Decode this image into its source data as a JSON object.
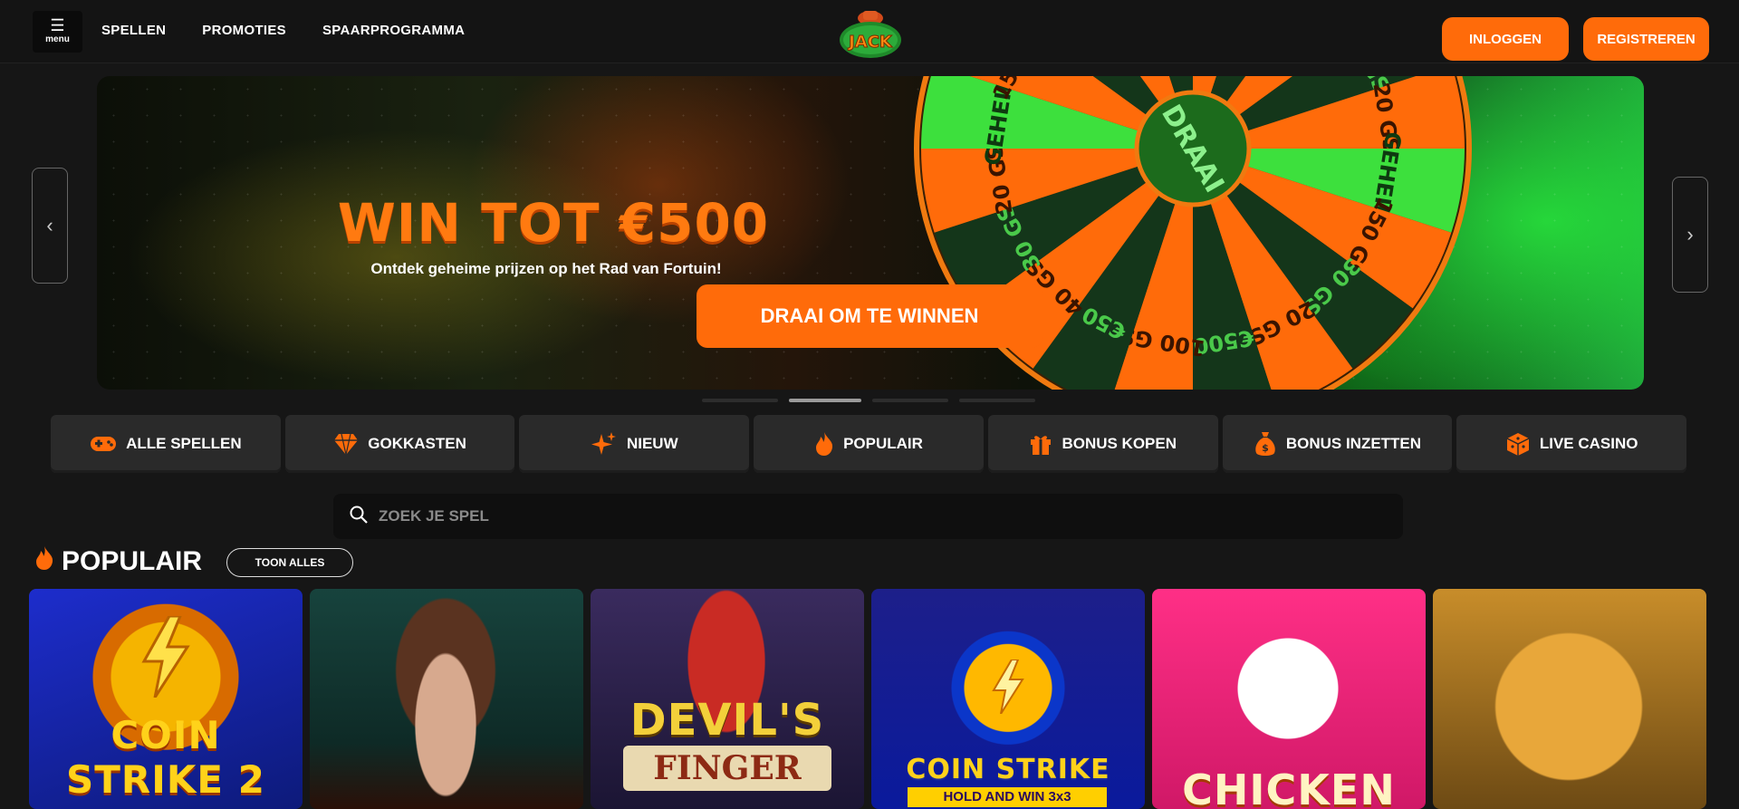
{
  "header": {
    "menu_icon": "hamburger-icon",
    "menu_label": "menu",
    "nav": [
      "SPELLEN",
      "PROMOTIES",
      "SPAARPROGRAMMA"
    ],
    "logo_text": "JACK",
    "login_label": "INLOGGEN",
    "register_label": "REGISTREREN"
  },
  "banner": {
    "title": "WIN TOT €500",
    "subtitle": "Ontdek geheime prijzen op het Rad van Fortuin!",
    "cta": "DRAAI OM TE WINNEN",
    "wheel_center": "DRAAI",
    "wheel_segments": [
      "100 GS",
      "€50",
      "40 GS",
      "30 GS",
      "20 GS",
      "GEHEIM",
      "150 GS",
      "30 GS",
      "20 GS",
      "€500"
    ],
    "slide_count": 4,
    "active_slide": 2,
    "prev_icon": "chevron-left-icon",
    "next_icon": "chevron-right-icon",
    "colors": {
      "accent": "#ff6b0a",
      "wheel_green": "#3de03d"
    }
  },
  "categories": [
    {
      "label": "ALLE SPELLEN",
      "icon": "gamepad-icon"
    },
    {
      "label": "GOKKASTEN",
      "icon": "diamond-icon"
    },
    {
      "label": "NIEUW",
      "icon": "sparkle-icon"
    },
    {
      "label": "POPULAIR",
      "icon": "flame-icon"
    },
    {
      "label": "BONUS KOPEN",
      "icon": "gift-icon"
    },
    {
      "label": "BONUS INZETTEN",
      "icon": "money-bag-icon"
    },
    {
      "label": "LIVE CASINO",
      "icon": "dice-icon"
    }
  ],
  "search": {
    "placeholder": "ZOEK JE SPEL",
    "icon": "search-icon"
  },
  "section": {
    "title": "POPULAIR",
    "show_all": "TOON ALLES",
    "games": [
      {
        "title": "COIN STRIKE 2"
      },
      {
        "title": ""
      },
      {
        "title": "DEVIL'S",
        "subtitle": "FINGER"
      },
      {
        "title": "COIN STRIKE",
        "subtitle": "HOLD AND WIN 3x3"
      },
      {
        "title": "CHICKEN"
      },
      {
        "title": ""
      }
    ]
  }
}
